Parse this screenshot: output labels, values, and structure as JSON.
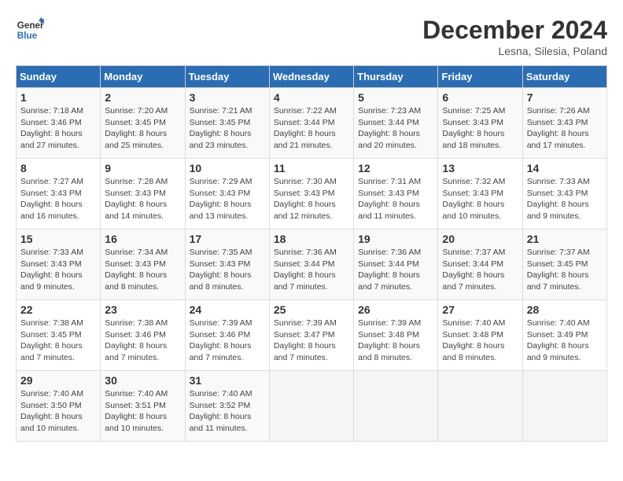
{
  "header": {
    "logo_line1": "General",
    "logo_line2": "Blue",
    "month_title": "December 2024",
    "subtitle": "Lesna, Silesia, Poland"
  },
  "days_of_week": [
    "Sunday",
    "Monday",
    "Tuesday",
    "Wednesday",
    "Thursday",
    "Friday",
    "Saturday"
  ],
  "weeks": [
    [
      {
        "day": "1",
        "info": "Sunrise: 7:18 AM\nSunset: 3:46 PM\nDaylight: 8 hours\nand 27 minutes."
      },
      {
        "day": "2",
        "info": "Sunrise: 7:20 AM\nSunset: 3:45 PM\nDaylight: 8 hours\nand 25 minutes."
      },
      {
        "day": "3",
        "info": "Sunrise: 7:21 AM\nSunset: 3:45 PM\nDaylight: 8 hours\nand 23 minutes."
      },
      {
        "day": "4",
        "info": "Sunrise: 7:22 AM\nSunset: 3:44 PM\nDaylight: 8 hours\nand 21 minutes."
      },
      {
        "day": "5",
        "info": "Sunrise: 7:23 AM\nSunset: 3:44 PM\nDaylight: 8 hours\nand 20 minutes."
      },
      {
        "day": "6",
        "info": "Sunrise: 7:25 AM\nSunset: 3:43 PM\nDaylight: 8 hours\nand 18 minutes."
      },
      {
        "day": "7",
        "info": "Sunrise: 7:26 AM\nSunset: 3:43 PM\nDaylight: 8 hours\nand 17 minutes."
      }
    ],
    [
      {
        "day": "8",
        "info": "Sunrise: 7:27 AM\nSunset: 3:43 PM\nDaylight: 8 hours\nand 16 minutes."
      },
      {
        "day": "9",
        "info": "Sunrise: 7:28 AM\nSunset: 3:43 PM\nDaylight: 8 hours\nand 14 minutes."
      },
      {
        "day": "10",
        "info": "Sunrise: 7:29 AM\nSunset: 3:43 PM\nDaylight: 8 hours\nand 13 minutes."
      },
      {
        "day": "11",
        "info": "Sunrise: 7:30 AM\nSunset: 3:43 PM\nDaylight: 8 hours\nand 12 minutes."
      },
      {
        "day": "12",
        "info": "Sunrise: 7:31 AM\nSunset: 3:43 PM\nDaylight: 8 hours\nand 11 minutes."
      },
      {
        "day": "13",
        "info": "Sunrise: 7:32 AM\nSunset: 3:43 PM\nDaylight: 8 hours\nand 10 minutes."
      },
      {
        "day": "14",
        "info": "Sunrise: 7:33 AM\nSunset: 3:43 PM\nDaylight: 8 hours\nand 9 minutes."
      }
    ],
    [
      {
        "day": "15",
        "info": "Sunrise: 7:33 AM\nSunset: 3:43 PM\nDaylight: 8 hours\nand 9 minutes."
      },
      {
        "day": "16",
        "info": "Sunrise: 7:34 AM\nSunset: 3:43 PM\nDaylight: 8 hours\nand 8 minutes."
      },
      {
        "day": "17",
        "info": "Sunrise: 7:35 AM\nSunset: 3:43 PM\nDaylight: 8 hours\nand 8 minutes."
      },
      {
        "day": "18",
        "info": "Sunrise: 7:36 AM\nSunset: 3:44 PM\nDaylight: 8 hours\nand 7 minutes."
      },
      {
        "day": "19",
        "info": "Sunrise: 7:36 AM\nSunset: 3:44 PM\nDaylight: 8 hours\nand 7 minutes."
      },
      {
        "day": "20",
        "info": "Sunrise: 7:37 AM\nSunset: 3:44 PM\nDaylight: 8 hours\nand 7 minutes."
      },
      {
        "day": "21",
        "info": "Sunrise: 7:37 AM\nSunset: 3:45 PM\nDaylight: 8 hours\nand 7 minutes."
      }
    ],
    [
      {
        "day": "22",
        "info": "Sunrise: 7:38 AM\nSunset: 3:45 PM\nDaylight: 8 hours\nand 7 minutes."
      },
      {
        "day": "23",
        "info": "Sunrise: 7:38 AM\nSunset: 3:46 PM\nDaylight: 8 hours\nand 7 minutes."
      },
      {
        "day": "24",
        "info": "Sunrise: 7:39 AM\nSunset: 3:46 PM\nDaylight: 8 hours\nand 7 minutes."
      },
      {
        "day": "25",
        "info": "Sunrise: 7:39 AM\nSunset: 3:47 PM\nDaylight: 8 hours\nand 7 minutes."
      },
      {
        "day": "26",
        "info": "Sunrise: 7:39 AM\nSunset: 3:48 PM\nDaylight: 8 hours\nand 8 minutes."
      },
      {
        "day": "27",
        "info": "Sunrise: 7:40 AM\nSunset: 3:48 PM\nDaylight: 8 hours\nand 8 minutes."
      },
      {
        "day": "28",
        "info": "Sunrise: 7:40 AM\nSunset: 3:49 PM\nDaylight: 8 hours\nand 9 minutes."
      }
    ],
    [
      {
        "day": "29",
        "info": "Sunrise: 7:40 AM\nSunset: 3:50 PM\nDaylight: 8 hours\nand 10 minutes."
      },
      {
        "day": "30",
        "info": "Sunrise: 7:40 AM\nSunset: 3:51 PM\nDaylight: 8 hours\nand 10 minutes."
      },
      {
        "day": "31",
        "info": "Sunrise: 7:40 AM\nSunset: 3:52 PM\nDaylight: 8 hours\nand 11 minutes."
      },
      {
        "day": "",
        "info": ""
      },
      {
        "day": "",
        "info": ""
      },
      {
        "day": "",
        "info": ""
      },
      {
        "day": "",
        "info": ""
      }
    ]
  ]
}
